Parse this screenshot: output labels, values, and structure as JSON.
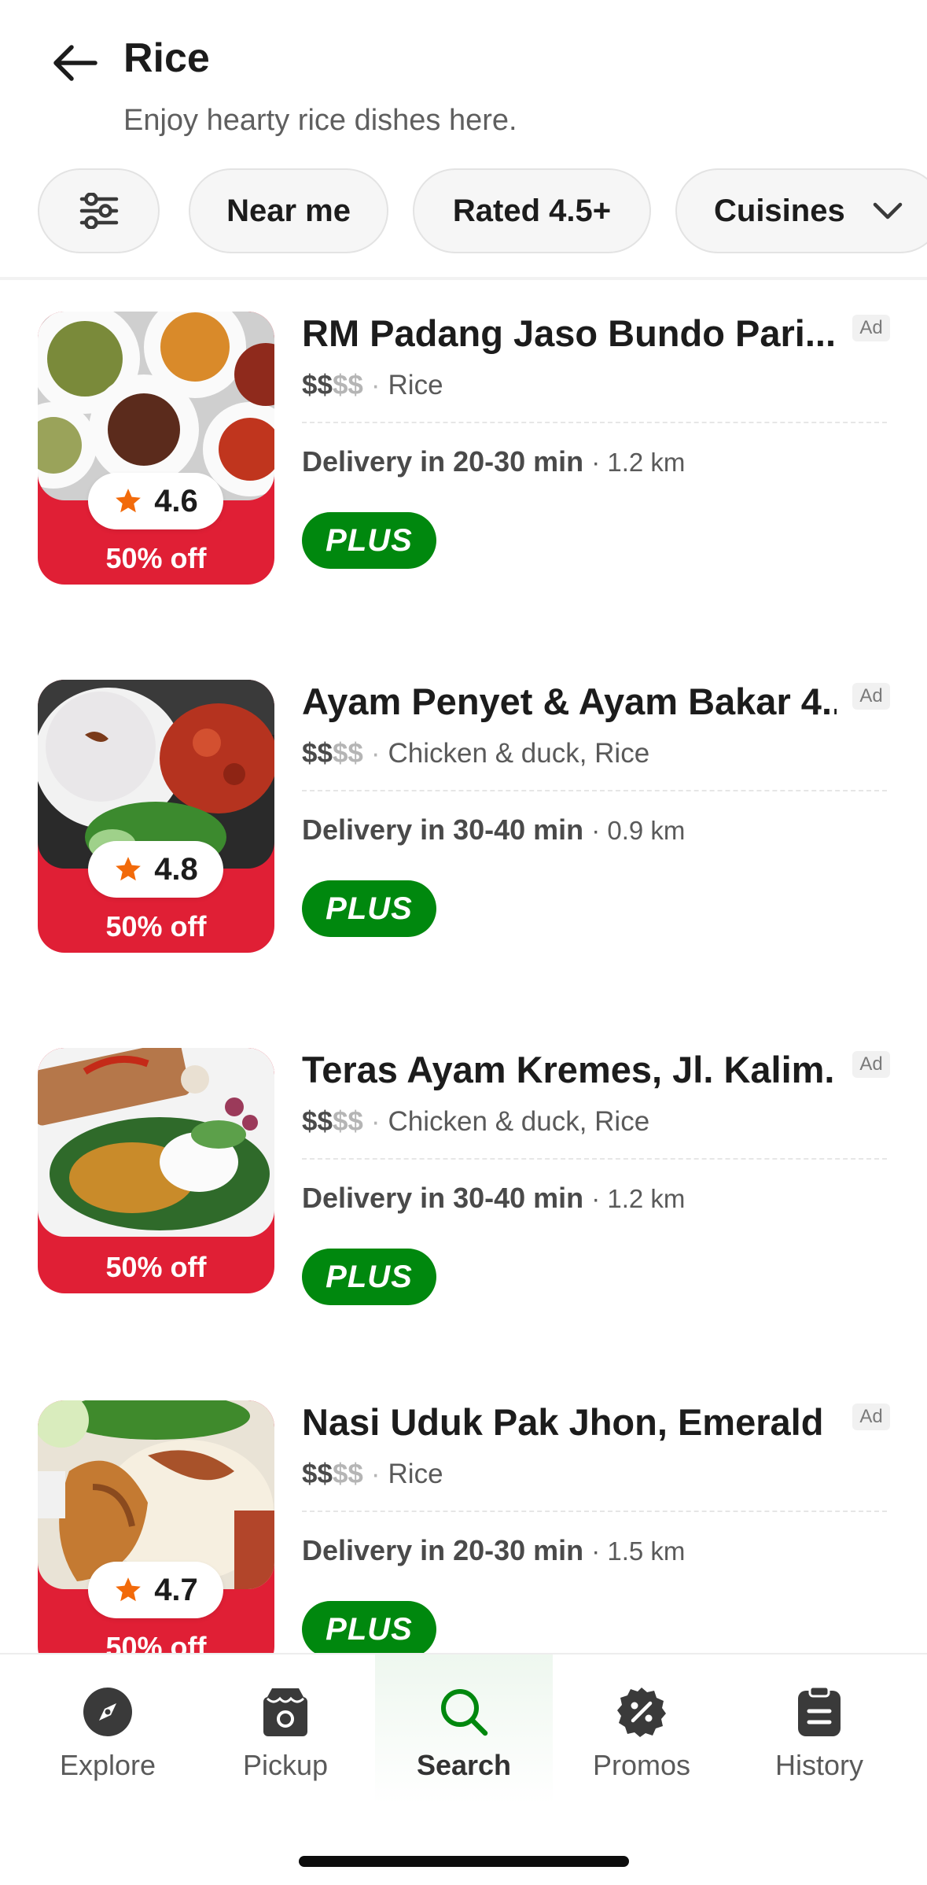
{
  "header": {
    "title": "Rice",
    "subtitle": "Enjoy hearty rice dishes here."
  },
  "filters": {
    "near_me": "Near me",
    "rated": "Rated 4.5+",
    "cuisines": "Cuisines"
  },
  "restaurants": [
    {
      "name": "RM Padang Jaso Bundo Pari...",
      "price_strong": "$$",
      "price_light": "$$",
      "categories": "Rice",
      "delivery": "Delivery in 20-30 min",
      "distance": "1.2 km",
      "rating": "4.6",
      "discount": "50% off",
      "ad": "Ad",
      "plus": "PLUS"
    },
    {
      "name": "Ayam Penyet & Ayam Bakar 4...",
      "price_strong": "$$",
      "price_light": "$$",
      "categories": "Chicken & duck, Rice",
      "delivery": "Delivery in 30-40 min",
      "distance": "0.9 km",
      "rating": "4.8",
      "discount": "50% off",
      "ad": "Ad",
      "plus": "PLUS"
    },
    {
      "name": "Teras Ayam Kremes, Jl. Kalim...",
      "price_strong": "$$",
      "price_light": "$$",
      "categories": "Chicken & duck, Rice",
      "delivery": "Delivery in 30-40 min",
      "distance": "1.2 km",
      "discount": "50% off",
      "ad": "Ad",
      "plus": "PLUS"
    },
    {
      "name": "Nasi Uduk Pak Jhon, Emerald",
      "price_strong": "$$",
      "price_light": "$$",
      "categories": "Rice",
      "delivery": "Delivery in 20-30 min",
      "distance": "1.5 km",
      "rating": "4.7",
      "discount": "50% off",
      "ad": "Ad",
      "plus": "PLUS"
    }
  ],
  "nav": {
    "explore": "Explore",
    "pickup": "Pickup",
    "search": "Search",
    "promos": "Promos",
    "history": "History"
  },
  "colors": {
    "brand_green": "#00880e",
    "discount_red": "#e01f35",
    "star_orange": "#f26a0a"
  }
}
